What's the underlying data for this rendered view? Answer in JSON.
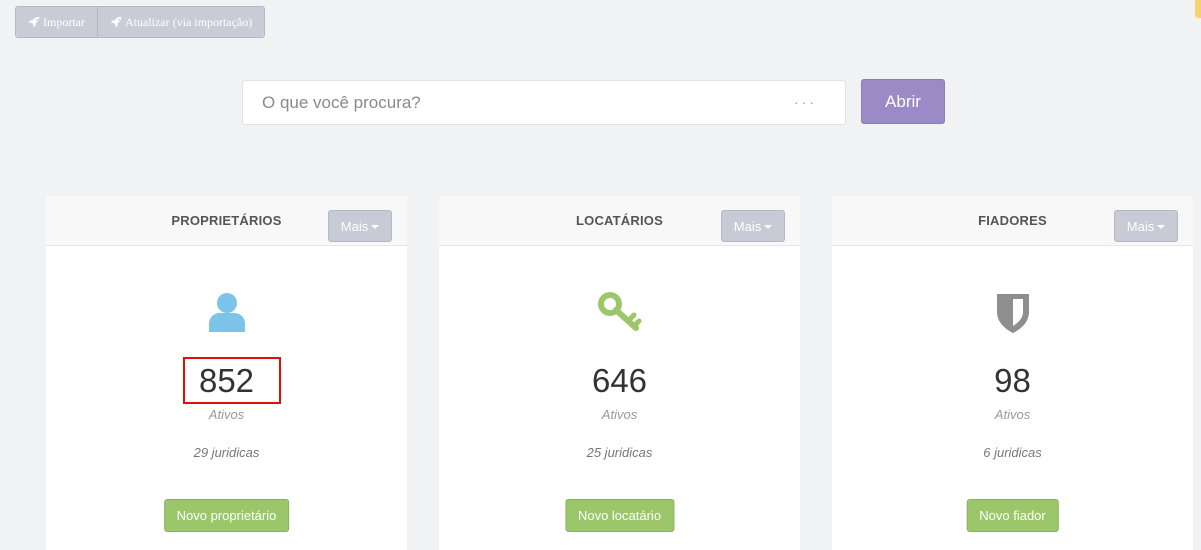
{
  "toolbar": {
    "import_label": "Importar",
    "update_label": "Atualizar (via importação)"
  },
  "search": {
    "placeholder": "O que você procura?",
    "dots": "···",
    "open_label": "Abrir"
  },
  "cards": [
    {
      "title": "PROPRIETÁRIOS",
      "more_label": "Mais",
      "icon": "user-icon",
      "icon_color": "#7dc4ea",
      "count": "852",
      "active_label": "Ativos",
      "legal_label": "29 juridicas",
      "new_label": "Novo proprietário"
    },
    {
      "title": "LOCATÁRIOS",
      "more_label": "Mais",
      "icon": "key-icon",
      "icon_color": "#9bc76a",
      "count": "646",
      "active_label": "Ativos",
      "legal_label": "25 juridicas",
      "new_label": "Novo locatário"
    },
    {
      "title": "FIADORES",
      "more_label": "Mais",
      "icon": "shield-icon",
      "icon_color": "#8e8e8e",
      "count": "98",
      "active_label": "Ativos",
      "legal_label": "6 juridicas",
      "new_label": "Novo fiador"
    }
  ],
  "colors": {
    "background": "#f1f2f4",
    "primary_button": "#9a8ac6",
    "success_button": "#9bc76a",
    "highlight_box": "#d9120f"
  }
}
